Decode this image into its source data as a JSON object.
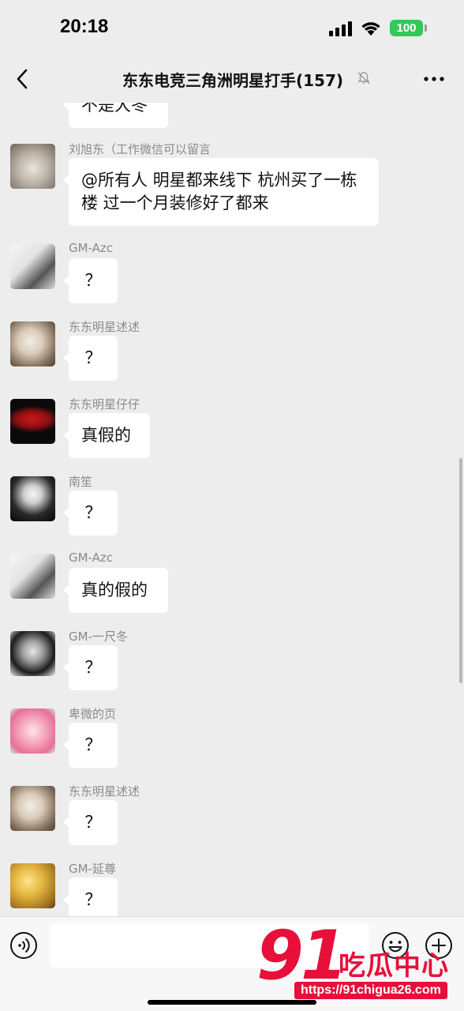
{
  "status_bar": {
    "time": "20:18",
    "battery": "100"
  },
  "nav": {
    "title": "东东电竞三角洲明星打手(157)"
  },
  "messages": [
    {
      "sender": "",
      "text": "不是大冬"
    },
    {
      "sender": "刘旭东（工作微信可以留言",
      "text": "@所有人 明星都来线下 杭州买了一栋楼 过一个月装修好了都来"
    },
    {
      "sender": "GM-Azc",
      "text": "？"
    },
    {
      "sender": "东东明星述述",
      "text": "？"
    },
    {
      "sender": "东东明星仔仔",
      "text": "真假的"
    },
    {
      "sender": "南笙",
      "text": "？"
    },
    {
      "sender": "GM-Azc",
      "text": "真的假的"
    },
    {
      "sender": "GM-一尺冬",
      "text": "？"
    },
    {
      "sender": "卑微的页",
      "text": "？"
    },
    {
      "sender": "东东明星述述",
      "text": "？"
    },
    {
      "sender": "GM-延尊",
      "text": "？"
    }
  ],
  "input": {
    "placeholder": ""
  },
  "watermark": {
    "brand": "91",
    "name": "吃瓜中心",
    "url": "https://91chigua26.com"
  },
  "colors": {
    "background": "#ededed",
    "bubble": "#ffffff",
    "battery": "#34c759",
    "watermark": "#e8103a"
  }
}
